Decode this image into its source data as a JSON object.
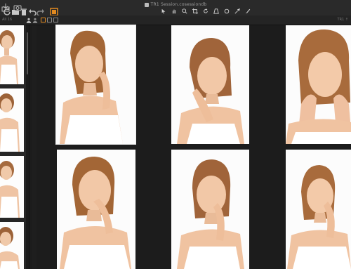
{
  "window": {
    "title": "TR1 Session.cosessiondb"
  },
  "colors": {
    "accent": "#e28a20",
    "background": "#1c1c1c",
    "toolbar": "#2a2a2a"
  },
  "toolbar": {
    "left_icons": [
      "import-icon",
      "camera-icon",
      "refresh-icon",
      "folder-open-icon",
      "trash-icon",
      "undo-icon",
      "redo-icon",
      "browser-icon"
    ],
    "center_icons": [
      "select-icon",
      "pan-icon",
      "zoom-icon",
      "crop-icon",
      "rotate-icon",
      "keystone-icon",
      "spot-icon",
      "picker-icon",
      "brush-icon"
    ],
    "right_label": "TR1 ↑ "
  },
  "subbar": {
    "left_text": "All 16",
    "icons": [
      "person-icon",
      "person-add-icon",
      "grid-view-icon",
      "single-view-icon",
      "compare-view-icon"
    ]
  },
  "filmstrip": {
    "items": [
      "thumb-1",
      "thumb-2",
      "thumb-3",
      "thumb-4"
    ]
  },
  "viewer": {
    "photos": [
      "photo-1",
      "photo-2",
      "photo-3",
      "photo-4",
      "photo-5",
      "photo-6"
    ]
  }
}
